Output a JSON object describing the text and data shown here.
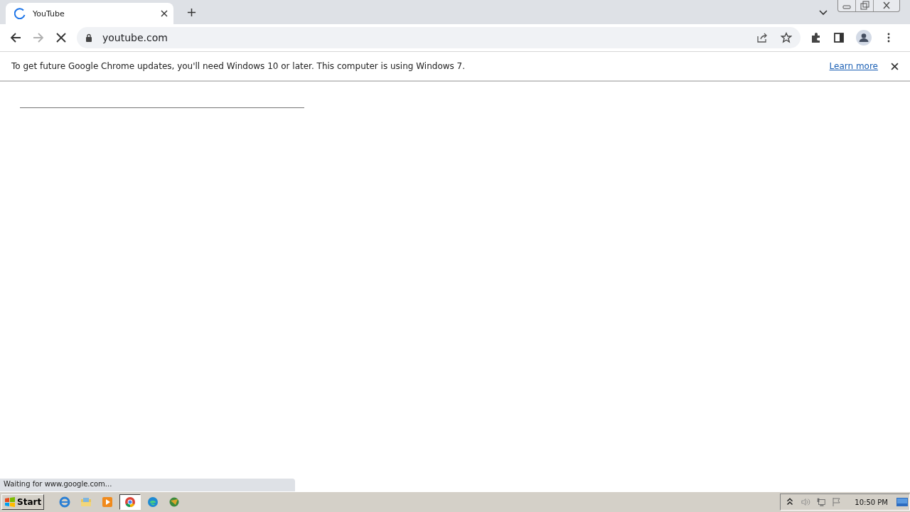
{
  "tabs": [
    {
      "title": "YouTube",
      "selected": true,
      "loading": true
    }
  ],
  "toolbar": {
    "address": "youtube.com",
    "forward_disabled": true
  },
  "infobar": {
    "message": "To get future Google Chrome updates, you'll need Windows 10 or later. This computer is using Windows 7.",
    "link": "Learn more"
  },
  "status_bubble": "Waiting for www.google.com...",
  "taskbar": {
    "start": "Start",
    "items": [
      {
        "kind": "ie",
        "selected": false
      },
      {
        "kind": "folder",
        "selected": false
      },
      {
        "kind": "media",
        "selected": false
      },
      {
        "kind": "chrome",
        "selected": true
      },
      {
        "kind": "edge",
        "selected": false
      },
      {
        "kind": "globe",
        "selected": false
      }
    ],
    "clock": "10:50 PM"
  }
}
